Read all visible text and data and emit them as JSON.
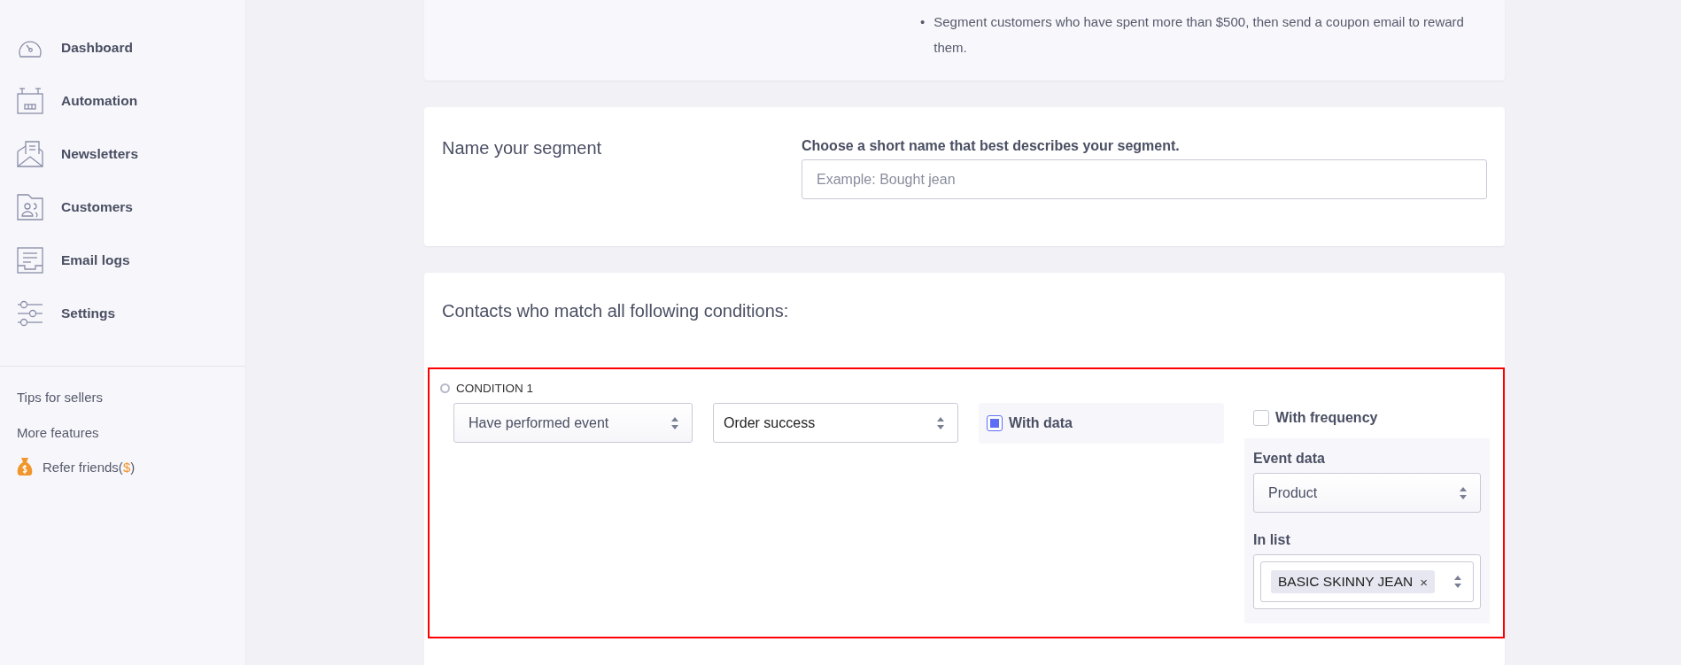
{
  "sidebar": {
    "nav_items": [
      {
        "label": "Dashboard",
        "kind": "dashboard"
      },
      {
        "label": "Automation",
        "kind": "automation"
      },
      {
        "label": "Newsletters",
        "kind": "newsletters"
      },
      {
        "label": "Customers",
        "kind": "customers"
      },
      {
        "label": "Email logs",
        "kind": "email_logs"
      },
      {
        "label": "Settings",
        "kind": "settings"
      }
    ],
    "footer_links": [
      {
        "label": "Tips for sellers"
      },
      {
        "label": "More features"
      }
    ],
    "refer": {
      "label": "Refer friends(",
      "accent": "$",
      "suffix": ")"
    }
  },
  "examples": {
    "items": [
      {
        "bullet": "•",
        "text": "Segment customers who have spent more than $500, then send a coupon email to reward them."
      }
    ]
  },
  "segment_name": {
    "title": "Name your segment",
    "label": "Choose a short name that best describes your segment.",
    "placeholder": "Example: Bought jean"
  },
  "conditions": {
    "heading": "Contacts who match all following conditions:",
    "items": [
      {
        "label": "CONDITION 1",
        "event_type": "Have performed event",
        "event": "Order success",
        "with_data": {
          "label": "With data",
          "checked": true
        },
        "with_frequency": {
          "label": "With frequency",
          "checked": false
        },
        "event_data": {
          "label": "Event data",
          "value": "Product"
        },
        "in_list": {
          "label": "In list",
          "tags": [
            {
              "label": "BASIC SKINNY JEAN",
              "remove": "×"
            }
          ]
        }
      }
    ]
  }
}
